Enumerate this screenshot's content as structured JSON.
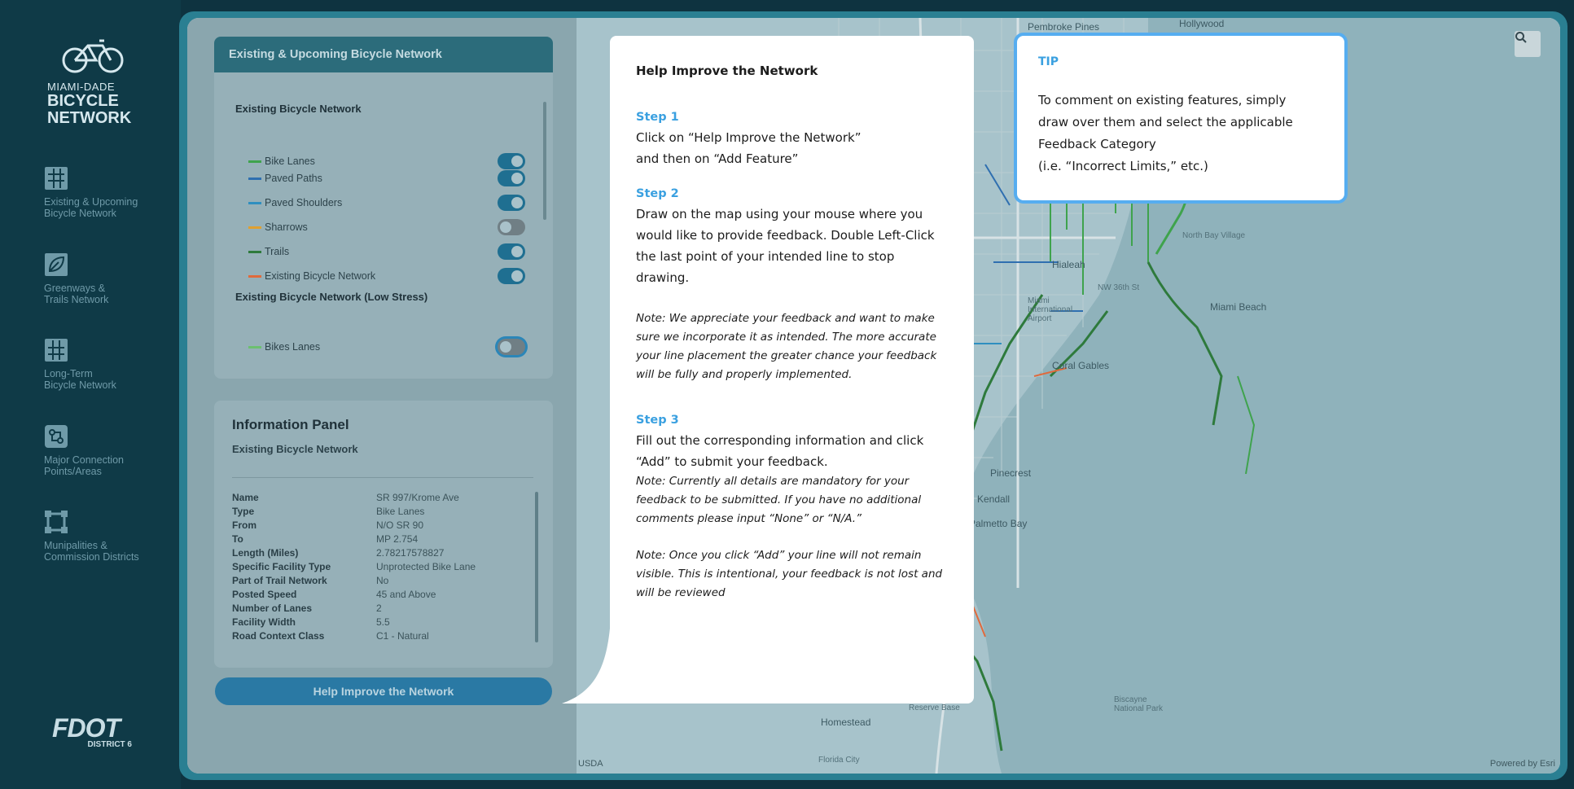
{
  "app": {
    "logo": {
      "line1": "MIAMI-DADE",
      "line2": "BICYCLE",
      "line3": "NETWORK"
    },
    "nav": [
      {
        "label1": "Existing & Upcoming",
        "label2": "Bicycle Network",
        "icon": "network-map-icon"
      },
      {
        "label1": "Greenways &",
        "label2": "Trails Network",
        "icon": "leaf-map-icon"
      },
      {
        "label1": "Long-Term",
        "label2": "Bicycle Network",
        "icon": "long-term-map-icon"
      },
      {
        "label1": "Major Connection",
        "label2": "Points/Areas",
        "icon": "connection-points-icon"
      },
      {
        "label1": "Munipalities &",
        "label2": "Commission Districts",
        "icon": "boundary-icon"
      }
    ],
    "fdot": {
      "name": "FDOT",
      "district": "DISTRICT 6"
    }
  },
  "layers_panel": {
    "title": "Existing & Upcoming Bicycle Network",
    "section1": "Existing Bicycle Network",
    "layers": [
      {
        "label": "Bike Lanes",
        "color": "#3fa34d",
        "on": true
      },
      {
        "label": "Paved Paths",
        "color": "#2f6fb0",
        "on": true
      },
      {
        "label": "Paved Shoulders",
        "color": "#2f8fc0",
        "on": true
      },
      {
        "label": "Sharrows",
        "color": "#e0a030",
        "on": false
      },
      {
        "label": "Trails",
        "color": "#2e7a3c",
        "on": true
      },
      {
        "label": "Existing Bicycle Network",
        "color": "#e06a3c",
        "on": true
      }
    ],
    "section2": "Existing Bicycle Network (Low Stress)",
    "layers2": [
      {
        "label": "Bikes Lanes",
        "color": "#6cc070",
        "on": false
      }
    ]
  },
  "info_panel": {
    "title": "Information Panel",
    "subtitle": "Existing Bicycle Network",
    "rows": [
      {
        "key": "Name",
        "value": "SR 997/Krome Ave"
      },
      {
        "key": "Type",
        "value": "Bike Lanes"
      },
      {
        "key": "From",
        "value": "N/O SR 90"
      },
      {
        "key": "To",
        "value": "MP 2.754"
      },
      {
        "key": "Length (Miles)",
        "value": "2.78217578827"
      },
      {
        "key": "Specific Facility Type",
        "value": "Unprotected Bike Lane"
      },
      {
        "key": "Part of Trail Network",
        "value": "No"
      },
      {
        "key": "Posted Speed",
        "value": "45 and Above"
      },
      {
        "key": "Number of Lanes",
        "value": "2"
      },
      {
        "key": "Facility Width",
        "value": "5.5"
      },
      {
        "key": "Road Context Class",
        "value": "C1 - Natural"
      }
    ],
    "help_button": "Help Improve the Network"
  },
  "dialog": {
    "title": "Help Improve  the Network",
    "step1_label": "Step 1",
    "step1_line1": "Click on “Help Improve the Network”",
    "step1_line2": "and then on “Add Feature”",
    "step2_label": "Step 2",
    "step2_text": "Draw on the map using your mouse where  you would like to provide feedback.  Double Left-Click the last point of your intended line to stop drawing.",
    "note1": "Note: We appreciate your feedback and want to make sure we incorporate it as intended. The more accurate your line placement the greater chance your feedback will be fully and properly implemented.",
    "step3_label": "Step 3",
    "step3_text": "Fill out the corresponding information and click “Add” to submit your feedback.",
    "note2": "Note: Currently all details are mandatory for your feedback to be submitted. If you have no additional comments please input “None” or “N/A.”",
    "note3": "Note: Once you click “Add” your line will not remain visible. This is intentional, your feedback is not lost and will be reviewed"
  },
  "tip": {
    "title": "TIP",
    "line1": "To comment on existing features,  simply",
    "line2": "draw over them and select  the applicable",
    "line3": "Feedback Category",
    "line4": "(i.e. “Incorrect  Limits,” etc.)"
  },
  "map": {
    "labels": [
      "Pembroke Pines",
      "Hollywood",
      "Hialeah",
      "NW 36th St",
      "Miami International Airport",
      "North Bay Village",
      "Miami Beach",
      "Coral Gables",
      "Pinecrest",
      "Kendall",
      "Palmetto Bay",
      "Homestead",
      "Florida City",
      "Biscayne National Park",
      "Reserve Base"
    ],
    "attribution_left": "USDA",
    "attribution_right": "Powered by Esri"
  }
}
